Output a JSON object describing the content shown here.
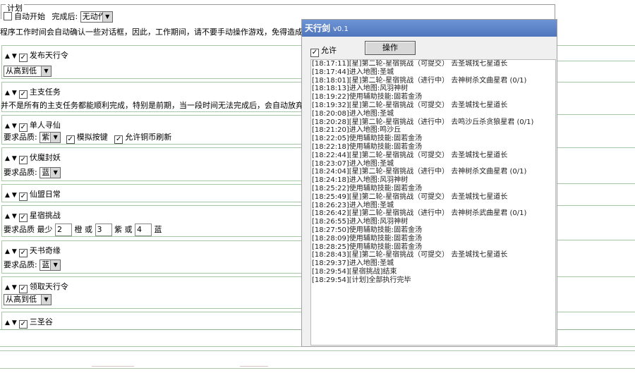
{
  "plan": {
    "legend": "计划",
    "auto_start_label": "自动开始",
    "after_complete_label": "完成后:",
    "after_complete_value": "无动作",
    "warning_text": "程序工作时间会自动确认一些对话框，因此，工作期间，请不要手动操作游戏，免得造成意"
  },
  "tasks": [
    {
      "name": "发布天行令",
      "select_value": "从高到低"
    },
    {
      "name": "主支任务",
      "note": "并不是所有的主支任务都能顺利完成，特别是前期，当一段时间无法完成后，会自动放弃"
    },
    {
      "name": "单人寻仙",
      "quality_label": "要求品质:",
      "quality_value": "紫",
      "simulate_key_label": "模拟按键",
      "allow_copper_refresh_label": "允许铜币刷新"
    },
    {
      "name": "伏魔封妖",
      "quality_label": "要求品质:",
      "quality_value": "蓝"
    },
    {
      "name": "仙盟日常"
    },
    {
      "name": "星宿挑战",
      "requirement_prefix": "要求品质 最少",
      "orange_count": "2",
      "orange_label": "橙 或",
      "purple_count": "3",
      "purple_label": "紫 或",
      "blue_count": "4",
      "blue_label": "蓝"
    },
    {
      "name": "天书奇缘",
      "quality_label": "要求品质:",
      "quality_value": "蓝"
    },
    {
      "name": "领取天行令",
      "select_value": "从高到低"
    },
    {
      "name": "三圣谷"
    }
  ],
  "window": {
    "title": "天行剑",
    "version": "v0.1",
    "allow_label": "允许",
    "operate_button": "操作"
  },
  "log": [
    "[18:17:11][星]第二轮-星宿挑战（可提交） 去圣城找七星道长",
    "[18:17:44]进入地图:圣城",
    "[18:18:01][星]第二轮-星宿挑战（进行中） 去神树杀文曲星君  (0/1)",
    "[18:18:13]进入地图:风羽神树",
    "[18:19:22]使用辅助技能:固若金汤",
    "[18:19:32][星]第二轮-星宿挑战（可提交） 去圣城找七星道长",
    "[18:20:08]进入地图:圣城",
    "[18:20:28][星]第二轮-星宿挑战（进行中） 去鸣沙丘杀贪狼星君  (0/1)",
    "[18:21:20]进入地图:鸣沙丘",
    "[18:22:05]使用辅助技能:固若金汤",
    "[18:22:18]使用辅助技能:固若金汤",
    "[18:22:44][星]第二轮-星宿挑战（可提交） 去圣城找七星道长",
    "[18:23:07]进入地图:圣城",
    "[18:24:04][星]第二轮-星宿挑战（进行中） 去神树杀文曲星君  (0/1)",
    "[18:24:18]进入地图:风羽神树",
    "[18:25:22]使用辅助技能:固若金汤",
    "[18:25:49][星]第二轮-星宿挑战（可提交） 去圣城找七星道长",
    "[18:26:23]进入地图:圣城",
    "[18:26:42][星]第二轮-星宿挑战（进行中） 去神树杀武曲星君  (0/1)",
    "[18:26:55]进入地图:风羽神树",
    "[18:27:50]使用辅助技能:固若金汤",
    "[18:28:09]使用辅助技能:固若金汤",
    "[18:28:25]使用辅助技能:固若金汤",
    "[18:28:43][星]第二轮-星宿挑战（可提交） 去圣城找七星道长",
    "[18:29:37]进入地图:圣城",
    "[18:29:54][星宿挑战]结束",
    "[18:29:54][计划]全部执行完毕"
  ]
}
